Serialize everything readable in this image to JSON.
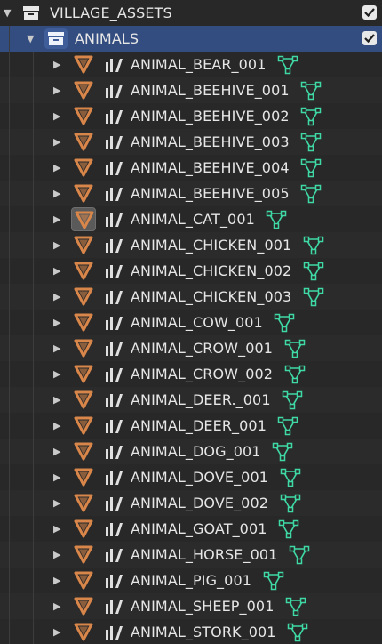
{
  "outliner": {
    "root_collection": {
      "label": "VILLAGE_ASSETS",
      "expanded": true,
      "icon": "collection-icon",
      "visible_checked": true
    },
    "child_collection": {
      "label": "ANIMALS",
      "expanded": true,
      "selected": true,
      "icon": "collection-icon",
      "visible_checked": true
    },
    "objects": [
      {
        "label": "ANIMAL_BEAR_001",
        "expanded": false,
        "active": false
      },
      {
        "label": "ANIMAL_BEEHIVE_001",
        "expanded": false,
        "active": false
      },
      {
        "label": "ANIMAL_BEEHIVE_002",
        "expanded": false,
        "active": false
      },
      {
        "label": "ANIMAL_BEEHIVE_003",
        "expanded": false,
        "active": false
      },
      {
        "label": "ANIMAL_BEEHIVE_004",
        "expanded": false,
        "active": false
      },
      {
        "label": "ANIMAL_BEEHIVE_005",
        "expanded": false,
        "active": false
      },
      {
        "label": "ANIMAL_CAT_001",
        "expanded": false,
        "active": true
      },
      {
        "label": "ANIMAL_CHICKEN_001",
        "expanded": false,
        "active": false
      },
      {
        "label": "ANIMAL_CHICKEN_002",
        "expanded": false,
        "active": false
      },
      {
        "label": "ANIMAL_CHICKEN_003",
        "expanded": false,
        "active": false
      },
      {
        "label": "ANIMAL_COW_001",
        "expanded": false,
        "active": false
      },
      {
        "label": "ANIMAL_CROW_001",
        "expanded": false,
        "active": false
      },
      {
        "label": "ANIMAL_CROW_002",
        "expanded": false,
        "active": false
      },
      {
        "label": "ANIMAL_DEER._001",
        "expanded": false,
        "active": false
      },
      {
        "label": "ANIMAL_DEER_001",
        "expanded": false,
        "active": false
      },
      {
        "label": "ANIMAL_DOG_001",
        "expanded": false,
        "active": false
      },
      {
        "label": "ANIMAL_DOVE_001",
        "expanded": false,
        "active": false
      },
      {
        "label": "ANIMAL_DOVE_002",
        "expanded": false,
        "active": false
      },
      {
        "label": "ANIMAL_GOAT_001",
        "expanded": false,
        "active": false
      },
      {
        "label": "ANIMAL_HORSE_001",
        "expanded": false,
        "active": false
      },
      {
        "label": "ANIMAL_PIG_001",
        "expanded": false,
        "active": false
      },
      {
        "label": "ANIMAL_SHEEP_001",
        "expanded": false,
        "active": false
      },
      {
        "label": "ANIMAL_STORK_001",
        "expanded": false,
        "active": false
      }
    ],
    "icons": {
      "object": "mesh-object-icon",
      "modifier": "modifier-wrench-icon",
      "data": "mesh-data-icon",
      "expander_collapsed": "disclosure-triangle-right-icon",
      "expander_expanded": "disclosure-triangle-down-icon",
      "checkbox": "checkbox-checked-icon"
    },
    "colors": {
      "background": "#282828",
      "selected_row": "#334d80",
      "object_icon": "#d9864a",
      "mesh_data_icon": "#3fd9a6",
      "text": "#e6e6e6"
    }
  }
}
